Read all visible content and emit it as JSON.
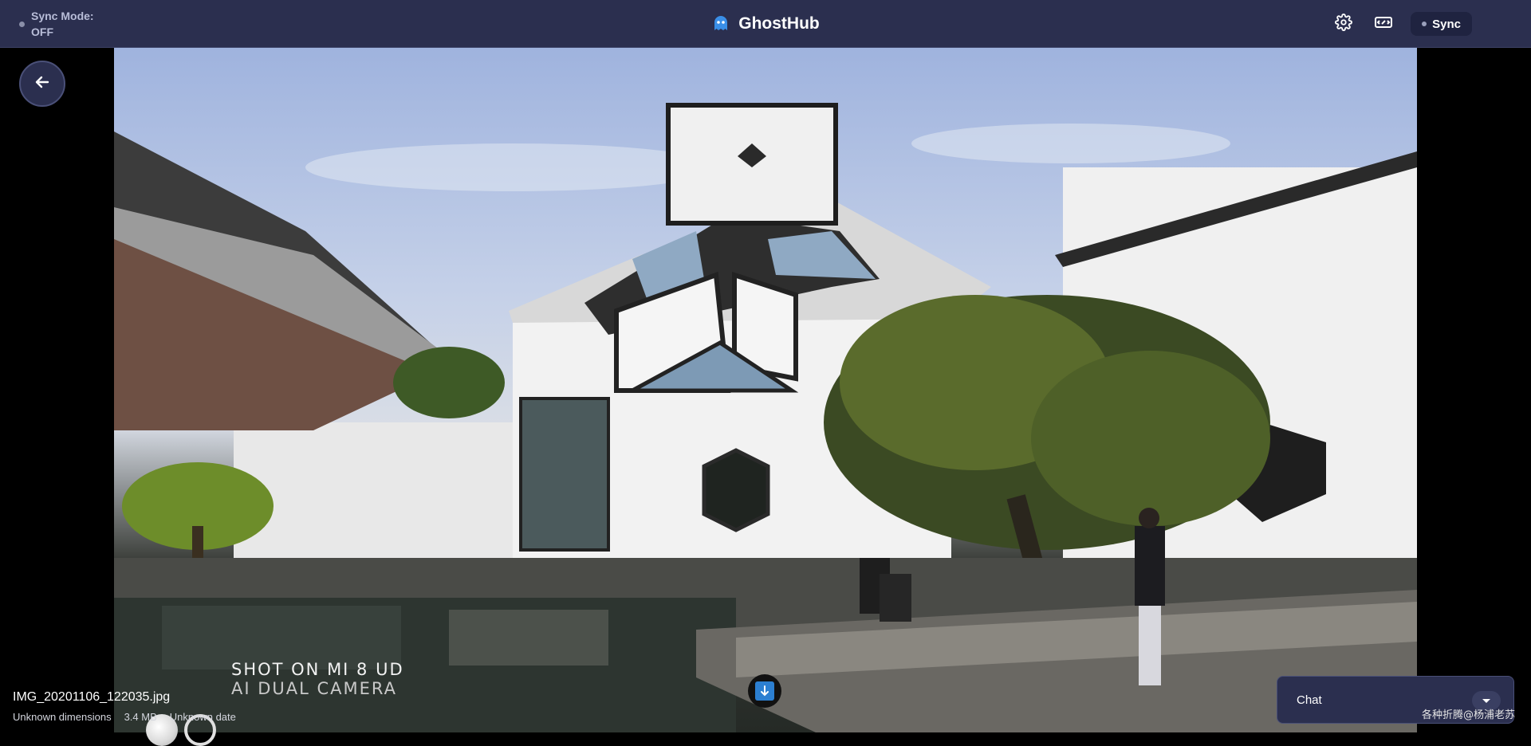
{
  "header": {
    "sync_mode_label": "Sync Mode:",
    "sync_mode_value": "OFF",
    "app_title": "GhostHub",
    "sync_button_label": "Sync",
    "accent": "#2b2f4f"
  },
  "viewer": {
    "file_name": "IMG_20201106_122035.jpg",
    "dimensions": "Unknown dimensions",
    "size": "3.4 MB",
    "date": "Unknown date",
    "camera_line1": "SHOT ON MI 8 UD",
    "camera_line2": "AI DUAL CAMERA",
    "watermark": "各种折腾@杨浦老苏"
  },
  "chat": {
    "label": "Chat"
  },
  "icons": {
    "settings": "gear-icon",
    "tunnel": "tunnel-icon",
    "back": "arrow-left-icon",
    "download": "download-icon",
    "chat_toggle": "chevron-down-icon",
    "brand": "ghost-icon"
  }
}
